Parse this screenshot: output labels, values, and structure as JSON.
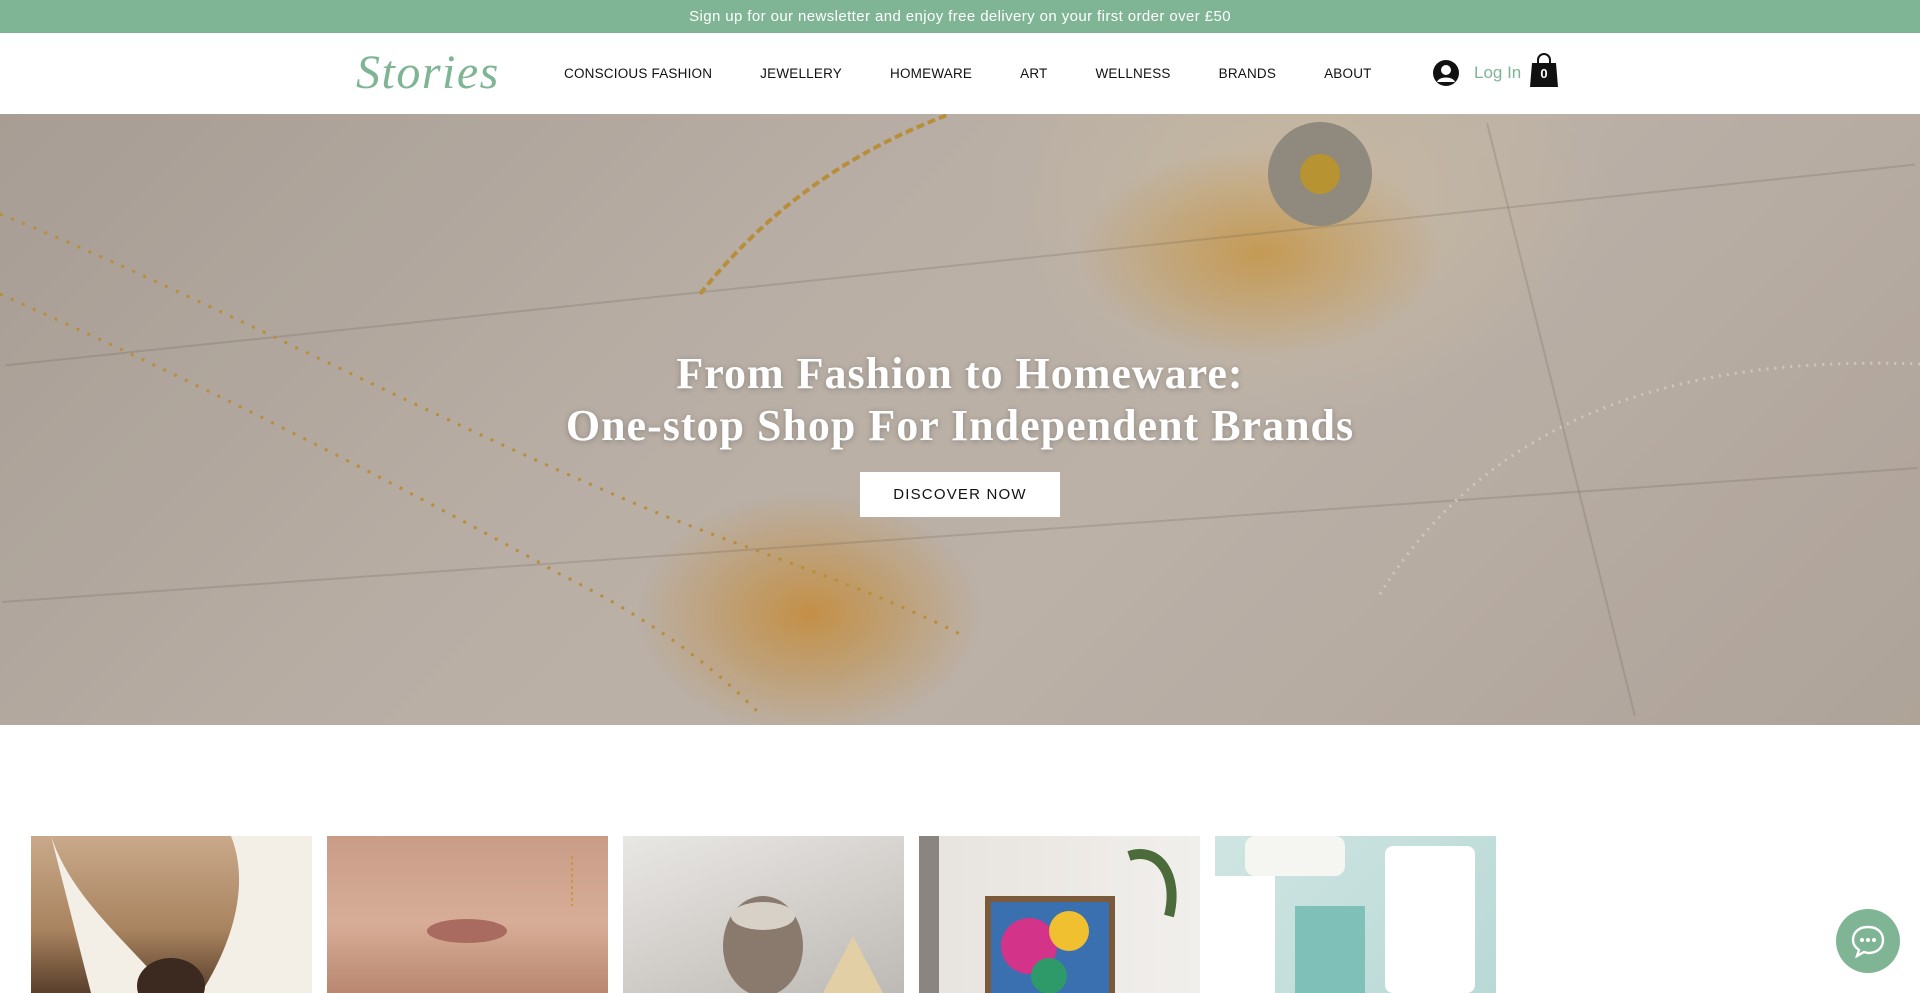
{
  "announcement": "Sign up for our newsletter and enjoy free delivery on your first order over £50",
  "header": {
    "logo": "Stories",
    "nav": [
      "CONSCIOUS FASHION",
      "JEWELLERY",
      "HOMEWARE",
      "ART",
      "WELLNESS",
      "BRANDS",
      "ABOUT"
    ],
    "login_label": "Log In",
    "cart_count": "0"
  },
  "hero": {
    "title_line1": "From Fashion to Homeware:",
    "title_line2": "One-stop Shop For Independent Brands",
    "button_label": "DISCOVER NOW"
  },
  "colors": {
    "accent": "#7fb594",
    "announcement_bg": "#7fb594",
    "button_bg": "#ffffff"
  },
  "icons": {
    "login": "avatar-icon",
    "cart": "shopping-bag-icon",
    "chat": "chat-icon"
  }
}
